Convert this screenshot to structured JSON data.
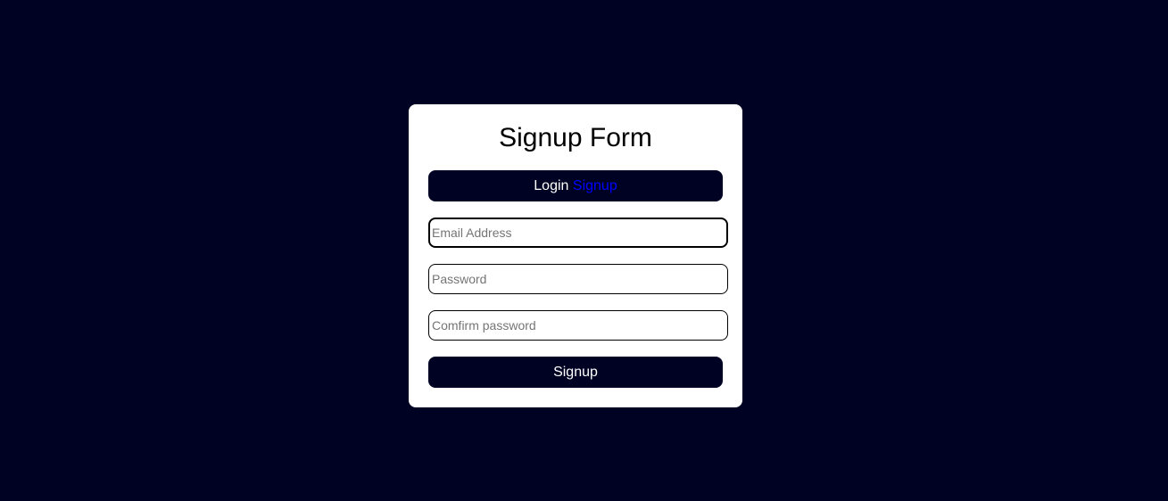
{
  "form": {
    "title": "Signup Form",
    "toggle": {
      "login_label": "Login",
      "signup_label": "Signup"
    },
    "fields": {
      "email": {
        "value": "",
        "placeholder": "Email Address"
      },
      "password": {
        "value": "",
        "placeholder": "Password"
      },
      "confirm_password": {
        "value": "",
        "placeholder": "Comfirm password"
      }
    },
    "submit_label": "Signup"
  },
  "colors": {
    "background": "#000223",
    "card": "#ffffff",
    "active_tab": "#0000ff",
    "button_text": "#ffffff"
  }
}
